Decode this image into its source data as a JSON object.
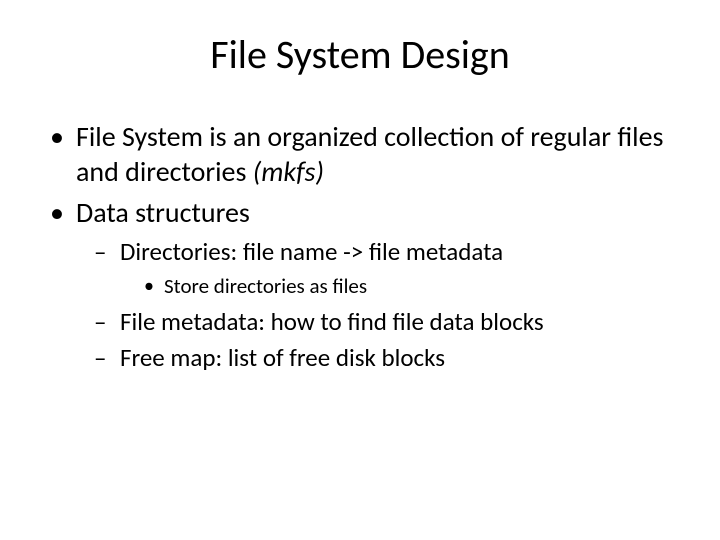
{
  "title": "File System Design",
  "bullets": {
    "b1_pre": "File System is an organized collection of regular files and directories ",
    "b1_italic": "(mkfs)",
    "b2": "Data structures",
    "b2_sub1": "Directories: file name -> file metadata",
    "b2_sub1_sub1": "Store directories as files",
    "b2_sub2": "File metadata: how to find file data blocks",
    "b2_sub3": "Free map: list of free disk blocks"
  }
}
